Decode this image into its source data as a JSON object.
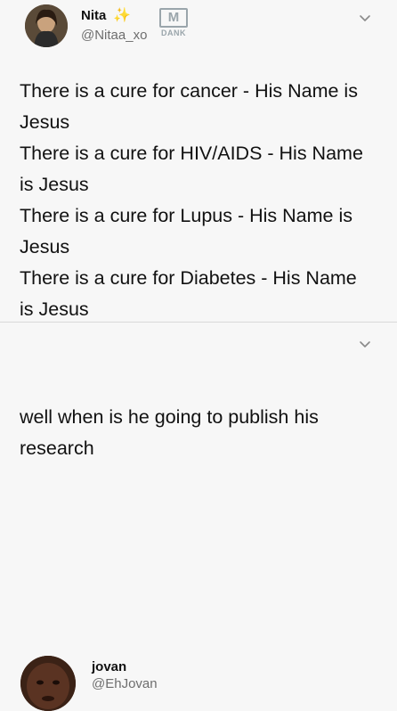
{
  "tweet": {
    "author": {
      "name": "Nita",
      "handle": "@Nitaa_xo"
    },
    "watermark": {
      "letter": "M",
      "text": "DANK"
    },
    "lines": [
      "There is a cure for cancer - His Name is",
      "Jesus",
      "There is a cure for HIV/AIDS - His Name",
      "is Jesus",
      "There is a cure for Lupus - His Name is",
      "Jesus",
      "There is a cure for Diabetes - His Name",
      "is Jesus"
    ]
  },
  "reply": {
    "author": {
      "name": "jovan",
      "handle": "@EhJovan"
    },
    "lines": [
      "well when is he going to publish his",
      "research"
    ]
  },
  "icons": {
    "sparkle": "sparkle-emoji-icon",
    "chevron": "chevron-down-icon"
  },
  "colors": {
    "background": "#f7f7f7",
    "text": "#111111",
    "handle": "#6e6e6e",
    "sparkle": "#f2c94c"
  }
}
